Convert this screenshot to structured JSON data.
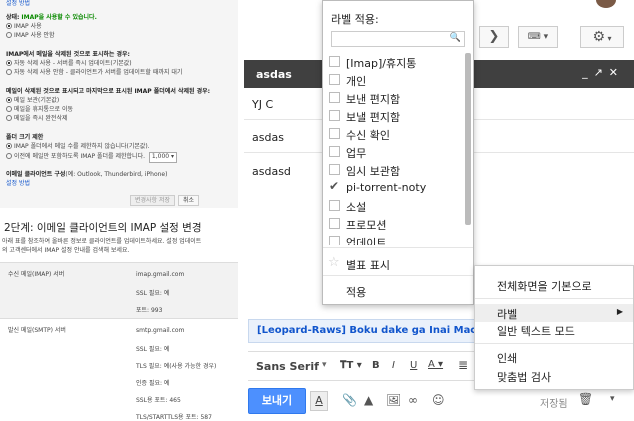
{
  "left": {
    "top_link": "설정 방법",
    "status_label": "상태:",
    "status_value": "IMAP을 사용할 수 있습니다.",
    "imap_on": "IMAP 사용",
    "imap_off": "IMAP 사용 안함",
    "delete_title": "IMAP에서 메일을 삭제된 것으로 표시하는 경우:",
    "delete_opt1": "자동 삭제 사용 - 서버를 즉시 업데이트(기본값)",
    "delete_opt2": "자동 삭제 사용 안함 - 클라이언트가 서버를 업데이트할 때까지 대기",
    "expunge_title": "메일이 삭제된 것으로 표시되고 마지막으로 표시된 IMAP 폴더에서 삭제된 경우:",
    "expunge_opt1": "메일 보관(기본값)",
    "expunge_opt2": "메일을 휴지통으로 이동",
    "expunge_opt3": "메일을 즉시 완전삭제",
    "folder_title": "폴더 크기 제한",
    "folder_opt1": "IMAP 폴더에서 메일 수를 제한하지 않습니다(기본값).",
    "folder_opt2": "이전에 메일만 포함하도록 IMAP 폴더를 제한합니다.",
    "folder_select": "1,000",
    "client_label": "이메일 클라이언트 구성",
    "client_hint": "(예: Outlook, Thunderbird, iPhone)",
    "client_link": "설정 방법",
    "save_btn": "변경사항 저장",
    "cancel_btn": "취소",
    "step_title": "2단계: 이메일 클라이언트의 IMAP 설정 변경",
    "step_desc1": "아래 표를 참조하여 올바른 정보로 클라이언트를 업데이트하세요. 설정 업데이트",
    "step_desc2": "의 고객센터에서 IMAP 설정 안내를 검색해 보세요.",
    "incoming_label": "수신 메일(IMAP) 서버",
    "incoming_vals": [
      "imap.gmail.com",
      "SSL 필요: 예",
      "포트: 993"
    ],
    "outgoing_label": "발신 메일(SMTP) 서버",
    "outgoing_vals": [
      "smtp.gmail.com",
      "SSL 필요: 예",
      "TLS 필요: 예(사용 가능한 경우)",
      "인증 필요: 예",
      "SSL용 포트: 465",
      "TLS/STARTTLS용 포트: 587"
    ]
  },
  "compose": {
    "title": "asdas",
    "to": "YJ C",
    "subject": "asdas",
    "body": "asdasd",
    "link_text": "[Leopard-Raws] Boku dake ga Inai Machi (CX",
    "font": "Sans Serif",
    "send": "보내기",
    "saved": "저장됨"
  },
  "label_menu": {
    "header": "라벨 적용:",
    "search_placeholder": "",
    "items": [
      {
        "label": "[Imap]/휴지통",
        "checked": false
      },
      {
        "label": "개인",
        "checked": false
      },
      {
        "label": "보낸 편지함",
        "checked": false
      },
      {
        "label": "보낼 편지함",
        "checked": false
      },
      {
        "label": "수신 확인",
        "checked": false
      },
      {
        "label": "업무",
        "checked": false
      },
      {
        "label": "임시 보관함",
        "checked": false
      },
      {
        "label": "pi-torrent-noty",
        "checked": true
      },
      {
        "label": "소설",
        "checked": false
      },
      {
        "label": "프로모션",
        "checked": false
      },
      {
        "label": "업데이트",
        "checked": false
      }
    ],
    "star": "별표 표시",
    "apply": "적용"
  },
  "context_menu": {
    "fullscreen": "전체화면을 기본으로",
    "label": "라벨",
    "plain_text": "일반 텍스트 모드",
    "print": "인쇄",
    "spellcheck": "맞춤법 검사"
  }
}
